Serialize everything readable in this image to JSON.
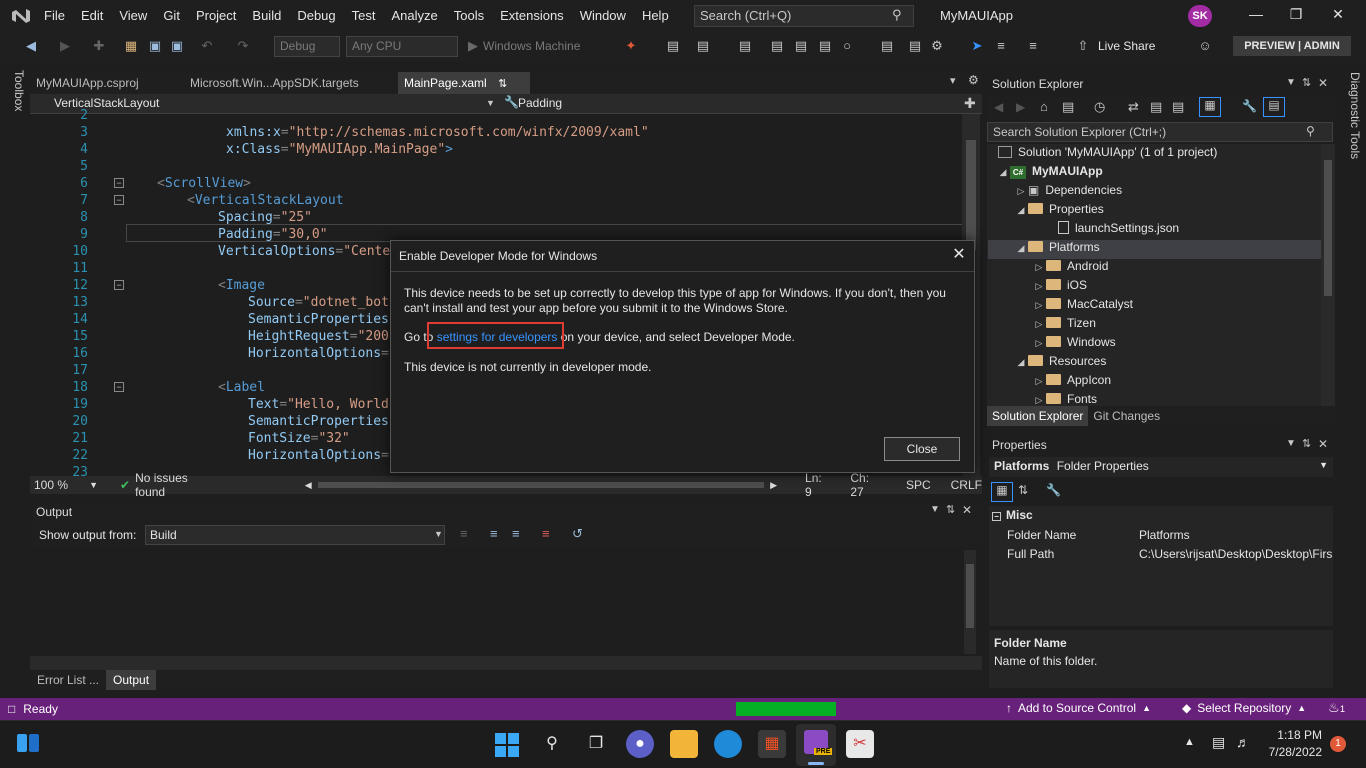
{
  "menu": {
    "items": [
      "File",
      "Edit",
      "View",
      "Git",
      "Project",
      "Build",
      "Debug",
      "Test",
      "Analyze",
      "Tools",
      "Extensions",
      "Window",
      "Help"
    ],
    "search_placeholder": "Search (Ctrl+Q)",
    "title": "MyMAUIApp",
    "avatar": "SK"
  },
  "toolbar": {
    "config": "Debug",
    "platform": "Any CPU",
    "run_target": "Windows Machine",
    "live_share": "Live Share",
    "preview_badge": "PREVIEW | ADMIN"
  },
  "left_strip": {
    "toolbox": "Toolbox"
  },
  "right_strip": {
    "diagnostic": "Diagnostic Tools"
  },
  "doc_tabs": [
    "MyMAUIApp.csproj",
    "Microsoft.Win...AppSDK.targets",
    "MainPage.xaml"
  ],
  "nav": {
    "left": "VerticalStackLayout",
    "right": "Padding"
  },
  "editor": {
    "line_numbers": [
      "2",
      "3",
      "4",
      "5",
      "6",
      "7",
      "8",
      "9",
      "10",
      "11",
      "12",
      "13",
      "14",
      "15",
      "16",
      "17",
      "18",
      "19",
      "20",
      "21",
      "22",
      "23"
    ],
    "lines": {
      "l3_attr": "xmlns:x",
      "l3_val": "\"http://schemas.microsoft.com/winfx/2009/xaml\"",
      "l4_attr": "x:Class",
      "l4_val": "\"MyMAUIApp.MainPage\"",
      "l4_end": ">",
      "l6_tag": "ScrollView",
      "l7_tag": "VerticalStackLayout",
      "l8_attr": "Spacing",
      "l8_val": "\"25\"",
      "l9_attr": "Padding",
      "l9_val": "\"30,0\"",
      "l10_attr": "VerticalOptions",
      "l10_val": "\"Center",
      "l12_tag": "Image",
      "l13_attr": "Source",
      "l13_val": "\"dotnet_bot.",
      "l14_attr": "SemanticProperties.",
      "l15_attr": "HeightRequest",
      "l15_val": "\"200\"",
      "l16_attr": "HorizontalOptions",
      "l16_val": "\"",
      "l18_tag": "Label",
      "l19_attr": "Text",
      "l19_val": "\"Hello, World!",
      "l20_attr": "SemanticProperties.",
      "l21_attr": "FontSize",
      "l21_val": "\"32\"",
      "l22_attr": "HorizontalOptions",
      "l22_val": "\""
    }
  },
  "editor_status": {
    "zoom": "100 %",
    "issues": "No issues found",
    "ln": "Ln: 9",
    "ch": "Ch: 27",
    "spc": "SPC",
    "crlf": "CRLF"
  },
  "output": {
    "title": "Output",
    "show_from_label": "Show output from:",
    "source": "Build",
    "tabs": [
      "Error List ...",
      "Output"
    ]
  },
  "solution_explorer": {
    "title": "Solution Explorer",
    "search_placeholder": "Search Solution Explorer (Ctrl+;)",
    "items": [
      "Solution 'MyMAUIApp' (1 of 1 project)",
      "MyMAUIApp",
      "Dependencies",
      "Properties",
      "launchSettings.json",
      "Platforms",
      "Android",
      "iOS",
      "MacCatalyst",
      "Tizen",
      "Windows",
      "Resources",
      "AppIcon",
      "Fonts"
    ],
    "project_badge": "C#",
    "tabs": [
      "Solution Explorer",
      "Git Changes"
    ]
  },
  "properties": {
    "title": "Properties",
    "object_name": "Platforms",
    "object_type": "Folder Properties",
    "category": "Misc",
    "rows": [
      {
        "name": "Folder Name",
        "value": "Platforms"
      },
      {
        "name": "Full Path",
        "value": "C:\\Users\\rijsat\\Desktop\\Desktop\\Firs"
      }
    ],
    "desc_title": "Folder Name",
    "desc_text": "Name of this folder."
  },
  "statusbar": {
    "ready": "Ready",
    "add_source": "Add to Source Control",
    "select_repo": "Select Repository",
    "notif_count": "1"
  },
  "taskbar": {
    "time": "1:18 PM",
    "date": "7/28/2022",
    "notif": "1",
    "vs_badge": "PRE"
  },
  "modal": {
    "title": "Enable Developer Mode for Windows",
    "para1": "This device needs to be set up correctly to develop this type of app for Windows. If you don't, then you can't install and test your app before you submit it to the Windows Store.",
    "para2_prefix": "Go to ",
    "link": "settings for developers",
    "para2_suffix": " on your device, and select Developer Mode.",
    "para3": "This device is not currently in developer mode.",
    "close_button": "Close"
  },
  "colors": {
    "accent_status": "#68217a",
    "progress": "#06b025",
    "link": "#3794ff",
    "highlight_box": "#e03c31"
  }
}
